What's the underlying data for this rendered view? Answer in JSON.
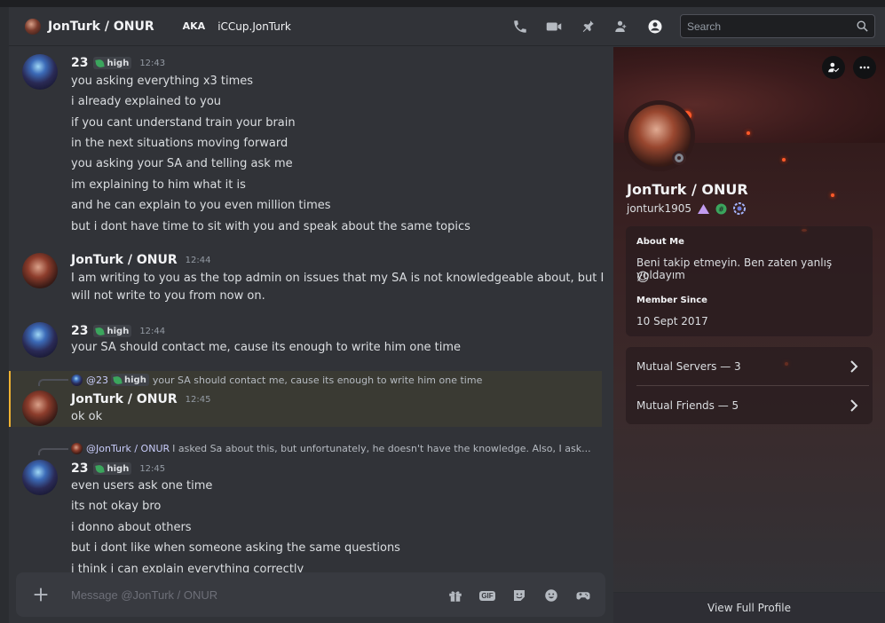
{
  "header": {
    "title": "JonTurk / ONUR",
    "aka_label": "AKA",
    "aka_name": "iCCup.JonTurk",
    "icons": [
      "phone-call-icon",
      "video-icon",
      "pin-icon",
      "add-friend-icon",
      "profile-toggle-icon"
    ],
    "search_placeholder": "Search"
  },
  "messages": {
    "m1": {
      "author": "23",
      "tag": "high",
      "time": "12:43",
      "lines": [
        "you asking everything x3 times",
        "i already explained to you",
        "if you cant understand train your brain",
        "in the next situations moving forward",
        "you asking your SA and telling ask me",
        "im explaining to him what it is",
        "and he can explain to you even million times",
        "but i dont have time to sit with you and speak about the same topics"
      ]
    },
    "m2": {
      "author": "JonTurk / ONUR",
      "time": "12:44",
      "lines": [
        "I am writing to you as the top admin on issues that my SA is not knowledgeable about, but I",
        "will not write to you from now on."
      ]
    },
    "m3": {
      "author": "23",
      "tag": "high",
      "time": "12:44",
      "lines": [
        "your SA should contact me, cause its enough to write him one time"
      ]
    },
    "m4": {
      "reply_author": "@23",
      "reply_tag": "high",
      "reply_text": "your SA should contact me, cause its enough to write him one time",
      "author": "JonTurk / ONUR",
      "time": "12:45",
      "lines": [
        "ok ok"
      ]
    },
    "m5": {
      "reply_author": "@JonTurk / ONUR",
      "reply_text": "I asked Sa about this, but unfortunately, he doesn't have the knowledge. Also, I ask...",
      "author": "23",
      "tag": "high",
      "time": "12:45",
      "lines": [
        "even users ask one time",
        "its not okay bro",
        "i donno about others",
        "but i dont like when someone asking the same questions",
        "i think i can explain everything correctly"
      ]
    }
  },
  "composer": {
    "placeholder": "Message @JonTurk / ONUR",
    "icons": [
      "gift-icon",
      "gif-icon",
      "sticker-icon",
      "emoji-icon",
      "activities-icon"
    ],
    "gif_label": "GIF"
  },
  "profile": {
    "display_name": "JonTurk / ONUR",
    "username": "jonturk1905",
    "about_title": "About Me",
    "about_text": "Beni takip etmeyin. Ben zaten yanlış yoldayım",
    "about_emoji": "😉",
    "member_title": "Member Since",
    "member_date": "10 Sept 2017",
    "mutual_servers": "Mutual Servers — 3",
    "mutual_friends": "Mutual Friends — 5",
    "footer": "View Full Profile"
  },
  "colors": {
    "accent_tag_leaf": "#3ba55d",
    "highlight_bar": "#f0b232",
    "background": "#313338"
  }
}
